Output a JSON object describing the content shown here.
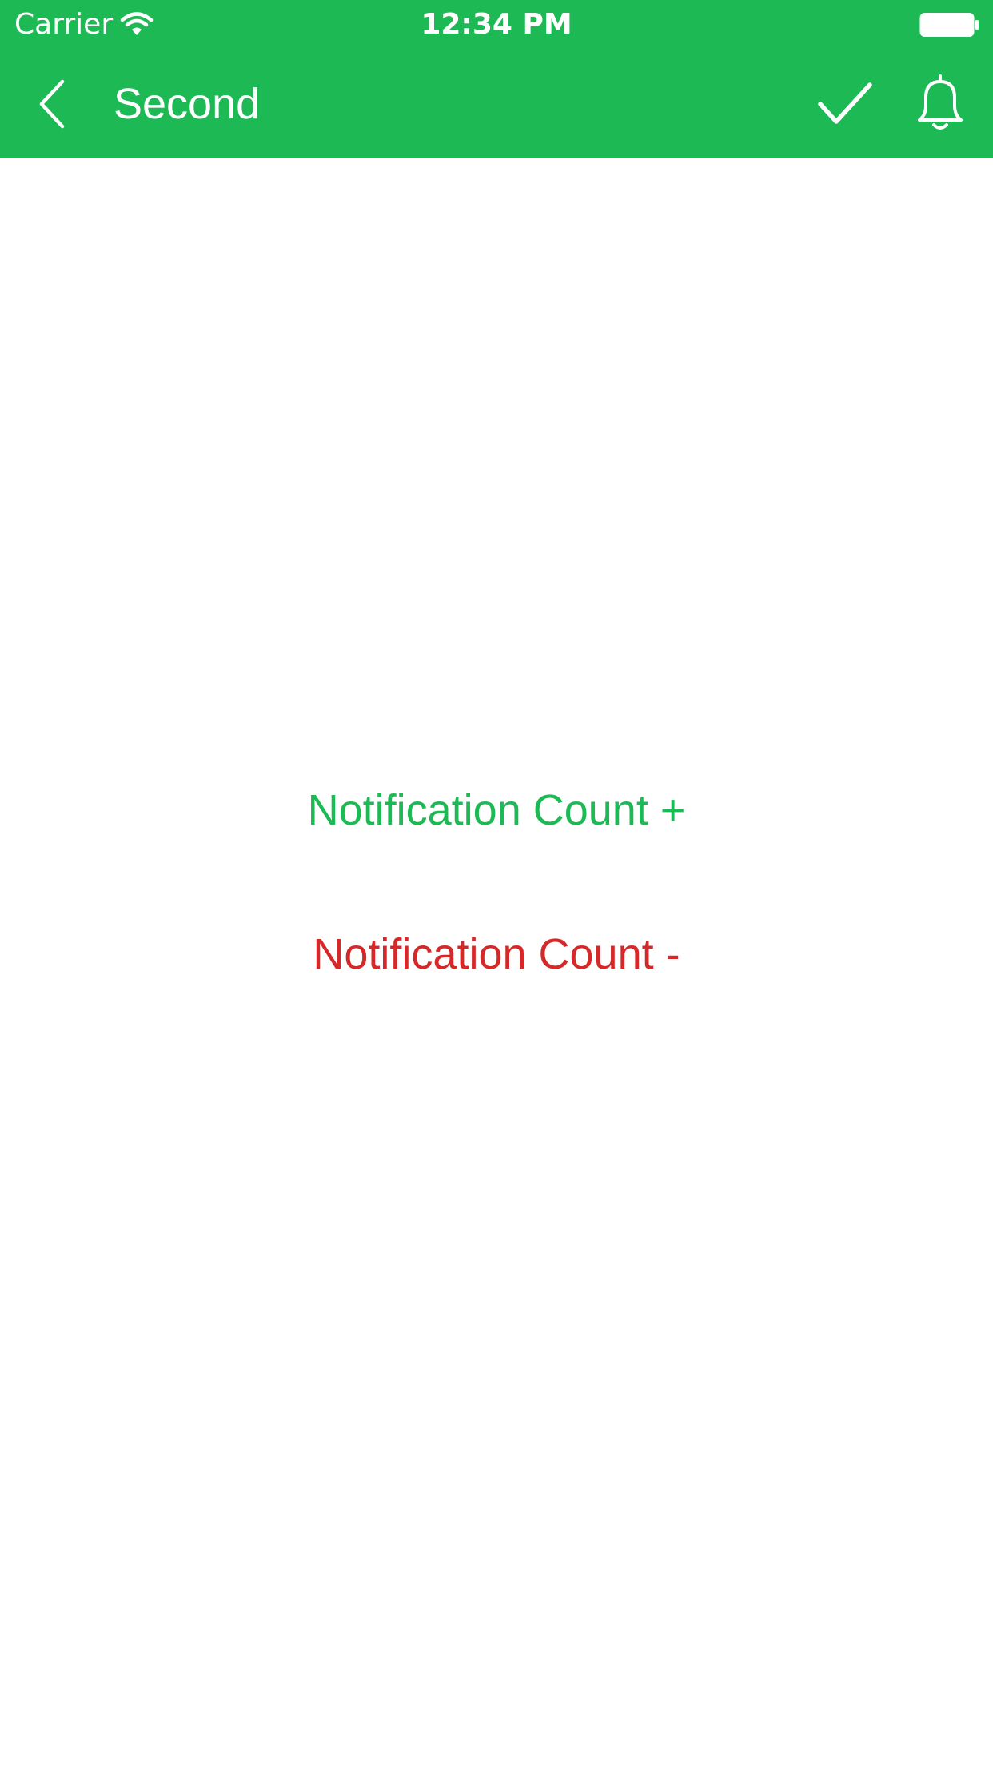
{
  "status_bar": {
    "carrier": "Carrier",
    "time": "12:34 PM",
    "wifi_icon": "wifi-icon",
    "battery_icon": "battery-icon"
  },
  "navbar": {
    "title": "Second",
    "back_icon": "chevron-left-icon",
    "check_icon": "checkmark-icon",
    "bell_icon": "bell-icon"
  },
  "buttons": {
    "increment_label": "Notification Count +",
    "decrement_label": "Notification Count -"
  },
  "colors": {
    "accent_green": "#1DB954",
    "danger_red": "#D62828",
    "background": "#FFFFFF"
  }
}
